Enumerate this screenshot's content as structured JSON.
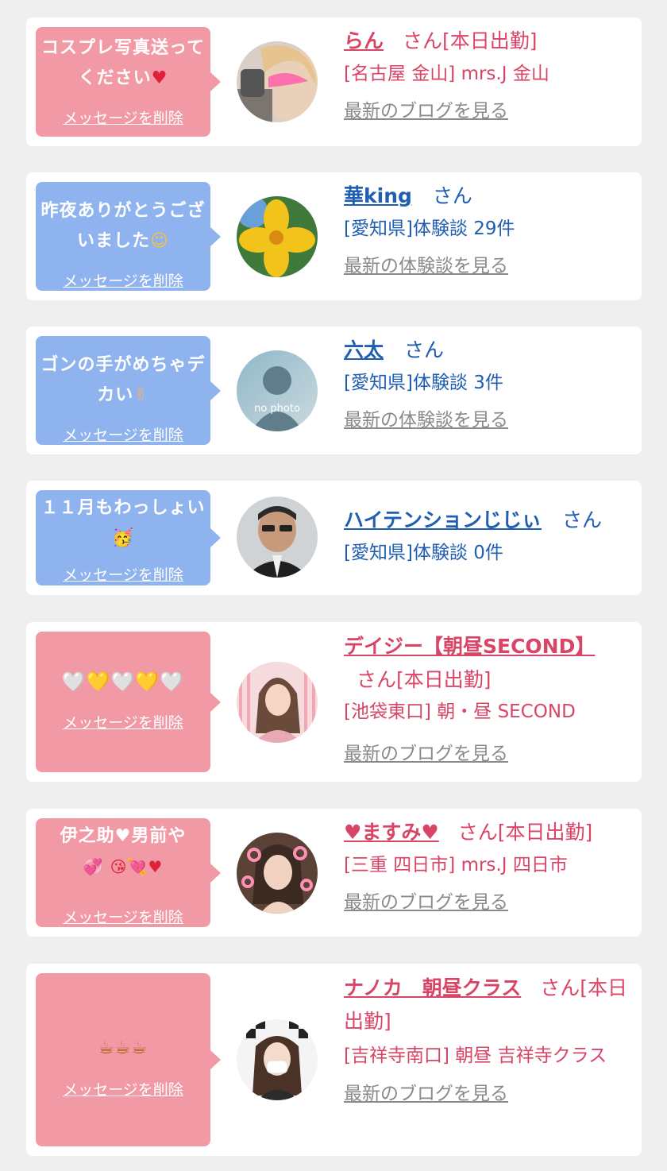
{
  "cards": [
    {
      "message": "コスプレ写真送ってください",
      "message_emoji": "♥",
      "delete_label": "メッセージを削除",
      "name": "らん",
      "suffix": "さん[本日出勤]",
      "sub": "[名古屋 金山] mrs.J 金山",
      "link": "最新のブログを見る"
    },
    {
      "message": "昨夜ありがとうございました",
      "message_emoji": "☺",
      "delete_label": "メッセージを削除",
      "name": "華king",
      "suffix": "さん",
      "sub": "[愛知県]体験談 29件",
      "link": "最新の体験談を見る"
    },
    {
      "message": "ゴンの手がめちゃデカい",
      "message_emoji": "✌",
      "delete_label": "メッセージを削除",
      "name": "六太",
      "suffix": "さん",
      "sub": "[愛知県]体験談 3件",
      "link": "最新の体験談を見る",
      "avatar_text": "no photo"
    },
    {
      "message": "１１月もわっしょい",
      "message_emoji": "🥳",
      "delete_label": "メッセージを削除",
      "name": "ハイテンションじじぃ",
      "suffix": "さん",
      "sub": "[愛知県]体験談 0件"
    },
    {
      "message": "🤍💛🤍💛🤍",
      "delete_label": "メッセージを削除",
      "name": "デイジー【朝昼SECOND】",
      "suffix": "さん[本日出勤]",
      "sub": "[池袋東口] 朝・昼 SECOND",
      "link": "最新のブログを見る"
    },
    {
      "message": "伊之助♥男前や",
      "message_emoji": "💞 😘💘♥",
      "delete_label": "メッセージを削除",
      "name": "♥ますみ♥",
      "suffix": "さん[本日出勤]",
      "sub": "[三重 四日市] mrs.J 四日市",
      "link": "最新のブログを見る"
    },
    {
      "message": "☕☕☕",
      "delete_label": "メッセージを削除",
      "name": "ナノカ　朝昼クラス",
      "suffix": "さん[本日出勤]",
      "sub": "[吉祥寺南口] 朝昼 吉祥寺クラス",
      "link": "最新のブログを見る"
    }
  ],
  "colors": {
    "pink_bubble": "#f19aa6",
    "blue_bubble": "#8fb3ee",
    "red_text": "#d94566",
    "blue_text": "#1f5eb0",
    "link_gray": "#8a8a8a"
  }
}
